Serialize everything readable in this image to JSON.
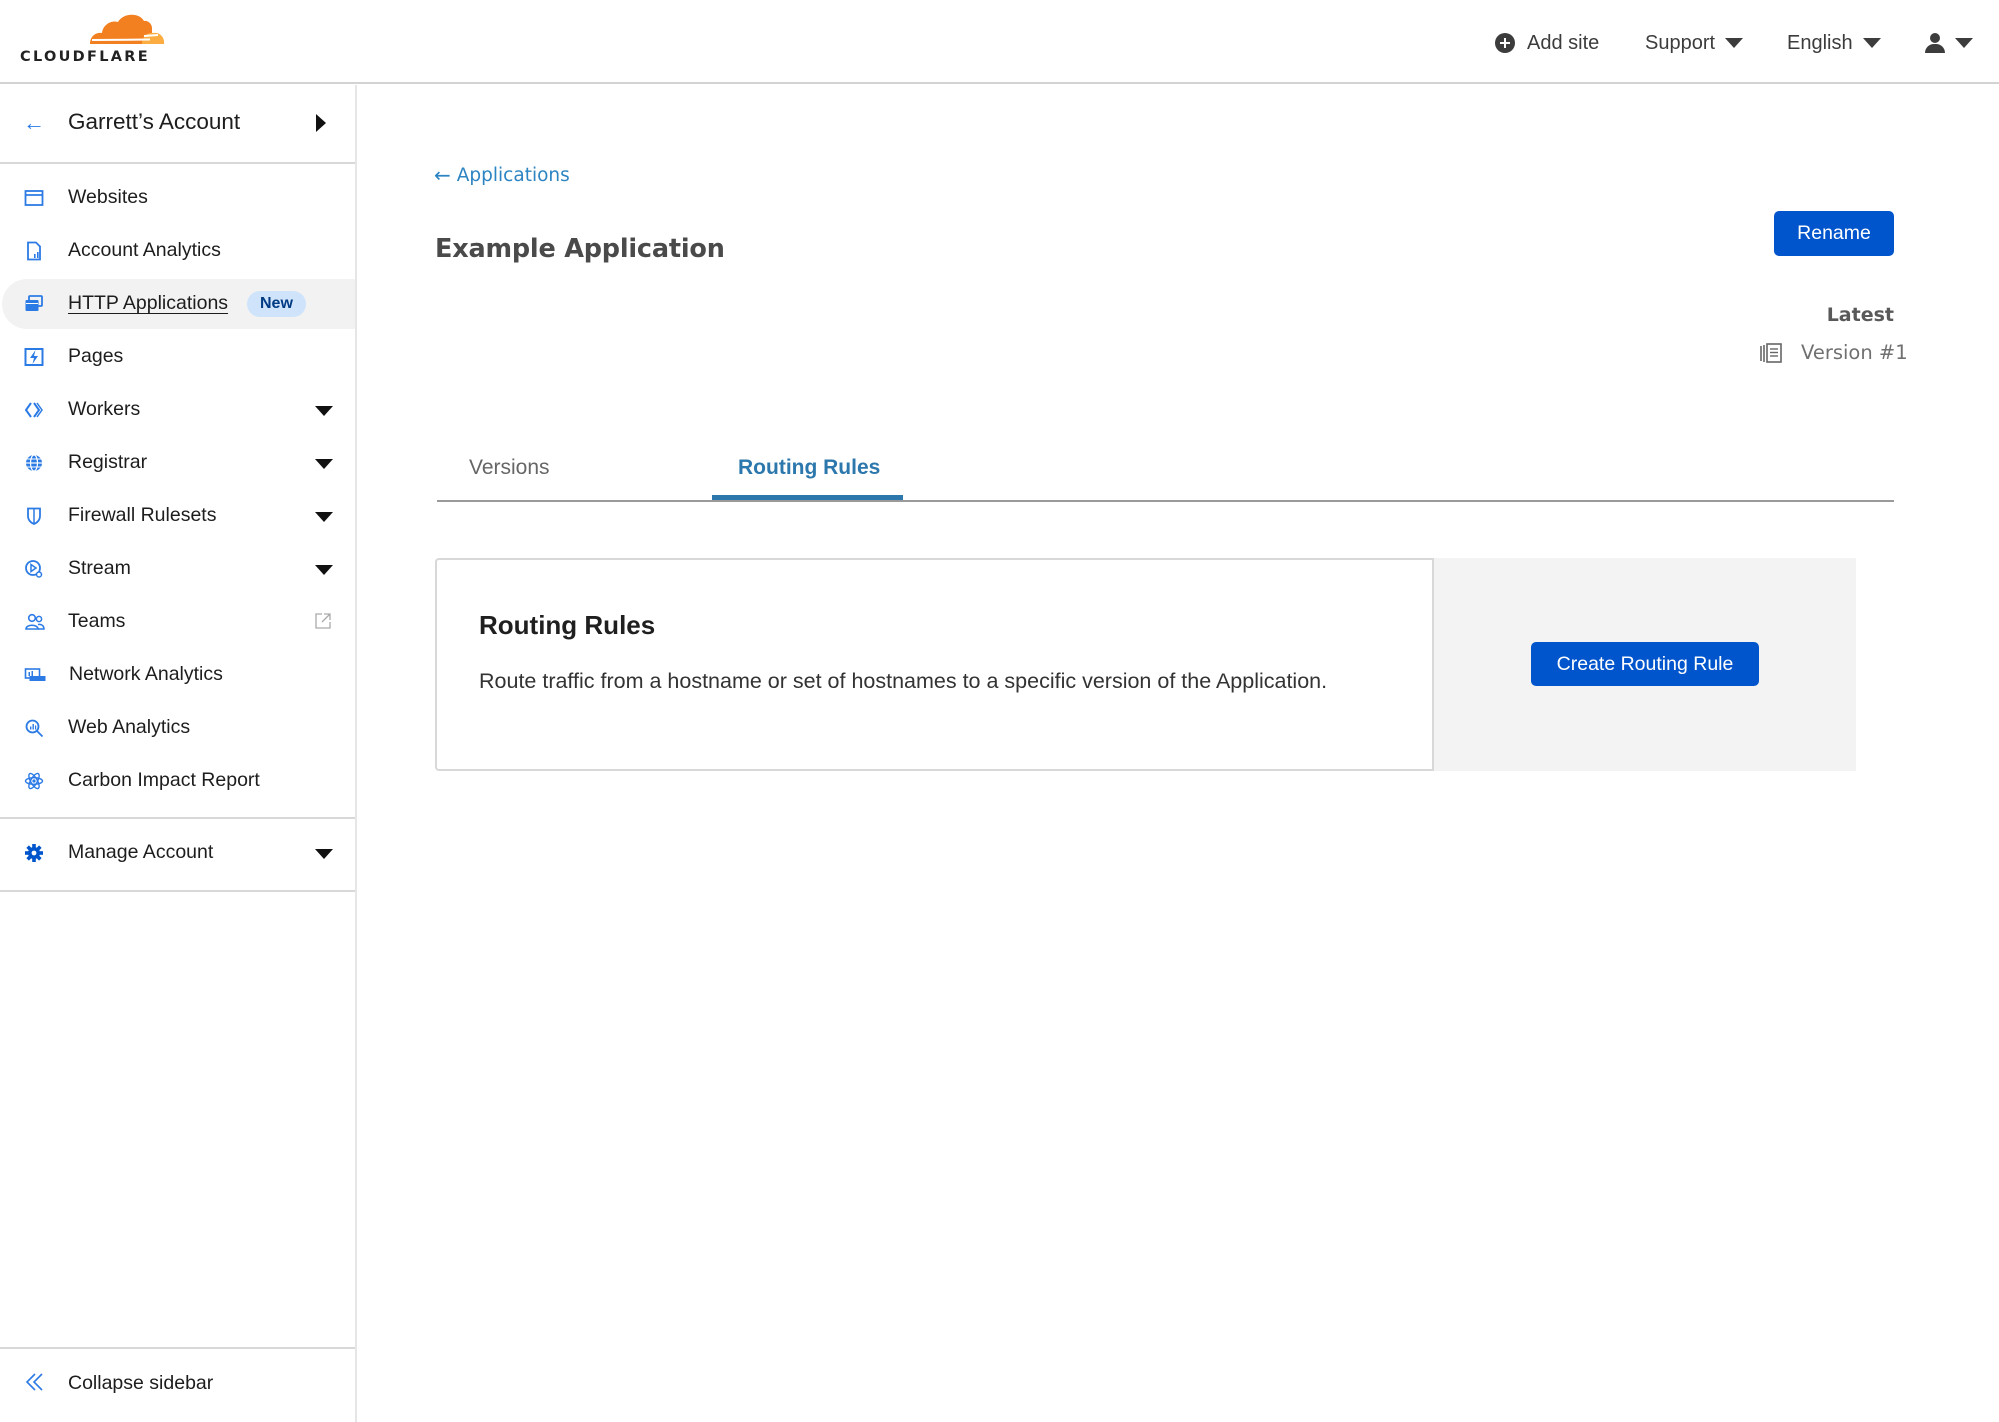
{
  "header": {
    "logo_text": "CLOUDFLARE",
    "add_site": "Add site",
    "support": "Support",
    "language": "English",
    "brand_orange": "#f38020",
    "brand_orange_light": "#fbad41"
  },
  "sidebar": {
    "account_name": "Garrett’s Account",
    "items": [
      {
        "label": "Websites",
        "icon": "browser-window-icon",
        "has_dropdown": false
      },
      {
        "label": "Account Analytics",
        "icon": "document-chart-icon",
        "has_dropdown": false
      },
      {
        "label": "HTTP Applications",
        "icon": "stacked-windows-icon",
        "has_dropdown": false,
        "active": true,
        "badge": "New"
      },
      {
        "label": "Pages",
        "icon": "lightning-icon",
        "has_dropdown": false
      },
      {
        "label": "Workers",
        "icon": "workers-icon",
        "has_dropdown": true
      },
      {
        "label": "Registrar",
        "icon": "globe-icon",
        "has_dropdown": true
      },
      {
        "label": "Firewall Rulesets",
        "icon": "shield-icon",
        "has_dropdown": true
      },
      {
        "label": "Stream",
        "icon": "play-circle-icon",
        "has_dropdown": true
      },
      {
        "label": "Teams",
        "icon": "users-icon",
        "external": true
      },
      {
        "label": "Network Analytics",
        "icon": "network-icon",
        "has_dropdown": false
      },
      {
        "label": "Web Analytics",
        "icon": "magnifier-chart-icon",
        "has_dropdown": false
      },
      {
        "label": "Carbon Impact Report",
        "icon": "atom-icon",
        "has_dropdown": false
      }
    ],
    "manage_account": "Manage Account",
    "collapse": "Collapse sidebar",
    "accent": "#2c7be5"
  },
  "main": {
    "breadcrumb": "Applications",
    "title": "Example Application",
    "rename_button": "Rename",
    "latest_label": "Latest",
    "version_label": "Version #1",
    "tabs": [
      {
        "label": "Versions",
        "active": false
      },
      {
        "label": "Routing Rules",
        "active": true
      }
    ],
    "card": {
      "title": "Routing Rules",
      "description": "Route traffic from a hostname or set of hostnames to a specific version of the Application.",
      "create_button": "Create Routing Rule"
    },
    "primary_color": "#0055cc",
    "tab_active_color": "#2c78ad"
  }
}
